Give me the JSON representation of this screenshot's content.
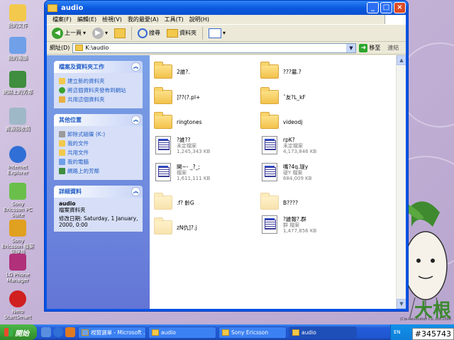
{
  "desktop": {
    "icons": [
      {
        "label": "我的文件",
        "color": "#f2c94c"
      },
      {
        "label": "我的電腦",
        "color": "#6fa0e8"
      },
      {
        "label": "網路上的芳鄰",
        "color": "#3f8d3f"
      },
      {
        "label": "資源回收筒",
        "color": "#9fb8c8"
      },
      {
        "label": "Internet Explorer",
        "color": "#2f6fd6"
      },
      {
        "label": "Sony Ericsson PC Suite",
        "color": "#6abf4b"
      },
      {
        "label": "Sony Ericsson 檔案管理員",
        "color": "#e0a020"
      },
      {
        "label": "LG Phone Manager",
        "color": "#b0307a"
      },
      {
        "label": "Nero StartSmart",
        "color": "#d02020"
      }
    ],
    "brand_text": "大根",
    "brand_sub": "(C)e-Revolution Co.,Ltd.2006"
  },
  "window": {
    "title": "audio",
    "menu": [
      "檔案(F)",
      "編輯(E)",
      "檢視(V)",
      "我的最愛(A)",
      "工具(T)",
      "說明(H)"
    ],
    "toolbar": {
      "back": "上一頁",
      "search": "搜尋",
      "folders": "資料夾"
    },
    "address": {
      "label": "網址(D)",
      "value": "K:\\audio",
      "go": "移至",
      "links": "連結"
    }
  },
  "left_pane": {
    "file_tasks": {
      "title": "檔案及資料夾工作",
      "items": [
        "建立新的資料夾",
        "將這個資料夾發佈到網站",
        "共用這個資料夾"
      ]
    },
    "other_places": {
      "title": "其他位置",
      "items": [
        "卸除式磁碟 (K:)",
        "我的文件",
        "共用文件",
        "我的電腦",
        "網路上的芳鄰"
      ]
    },
    "details": {
      "title": "詳細資料",
      "name": "audio",
      "type": "檔案資料夾",
      "modified": "修改日期: Saturday, 1 January, 2000, 0:00"
    }
  },
  "files": [
    {
      "name": "2誰?.",
      "type": "folder"
    },
    {
      "name": "???墓.?",
      "type": "folder"
    },
    {
      "name": "]??(?.pl+",
      "type": "folder"
    },
    {
      "name": "ˇ友?L_kF",
      "type": "folder"
    },
    {
      "name": "ringtones",
      "type": "folder"
    },
    {
      "name": "videodj",
      "type": "folder"
    },
    {
      "name": "?誰??",
      "sub1": "未定檔案",
      "sub2": "1,245,343 KB",
      "type": "file"
    },
    {
      "name": "rpK?",
      "sub1": "未定檔案",
      "sub2": "4,173,846 KB",
      "type": "file"
    },
    {
      "name": "開~- _?_;",
      "sub1": "檔案",
      "sub2": "1,611,111 KB",
      "type": "file"
    },
    {
      "name": "嘴?4q.瑅y",
      "sub1": "瑅Y 檔案",
      "sub2": "684,009 KB",
      "type": "file"
    },
    {
      "name": ".f?   齡G",
      "type": "folder-faded"
    },
    {
      "name": "B????",
      "type": "folder-faded"
    },
    {
      "name": "zN仇]?.j",
      "type": "folder-faded"
    },
    {
      "name": "?誰報?.群",
      "sub1": "群 檔案",
      "sub2": "1,477,856 KB",
      "type": "file"
    }
  ],
  "taskbar": {
    "start": "開始",
    "buttons": [
      "視窗選單 - Microsoft ...",
      "audio",
      "Sony Ericsson",
      "audio"
    ],
    "lang": "EN",
    "badge": "#345743"
  }
}
